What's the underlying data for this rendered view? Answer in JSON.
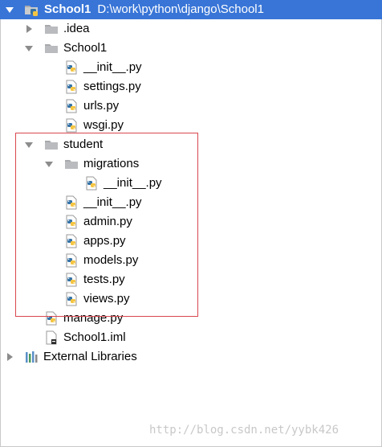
{
  "root": {
    "name": "School1",
    "path": "D:\\work\\python\\django\\School1"
  },
  "tree": {
    "idea": ".idea",
    "school1_dir": "School1",
    "school1_init": "__init__.py",
    "settings": "settings.py",
    "urls": "urls.py",
    "wsgi": "wsgi.py",
    "student": "student",
    "migrations": "migrations",
    "migrations_init": "__init__.py",
    "student_init": "__init__.py",
    "admin": "admin.py",
    "apps": "apps.py",
    "models": "models.py",
    "tests": "tests.py",
    "views": "views.py",
    "manage": "manage.py",
    "iml": "School1.iml",
    "external": "External Libraries"
  },
  "watermark": "http://blog.csdn.net/yybk426",
  "colors": {
    "selection": "#3875d7",
    "folder": "#a7a9ac",
    "python_blue": "#3572a5",
    "python_yellow": "#f5c542",
    "highlight_box": "#d9474f"
  }
}
